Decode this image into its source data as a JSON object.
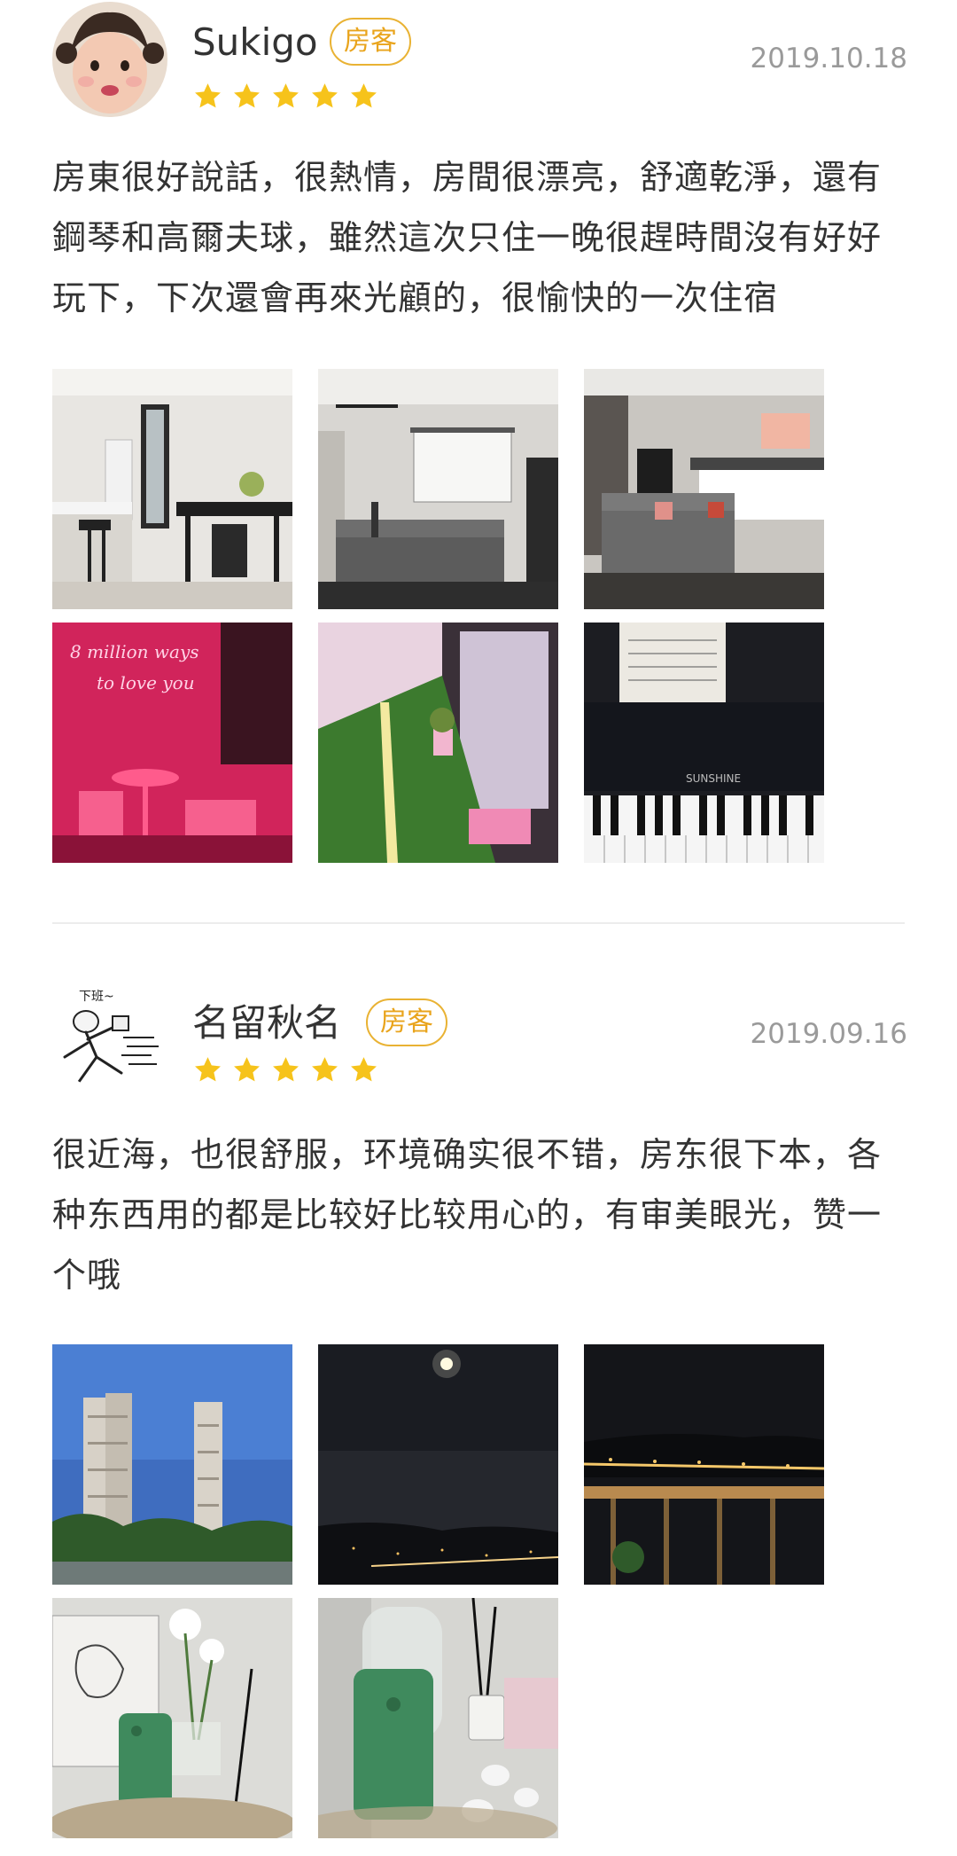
{
  "reviews": [
    {
      "username": "Sukigo",
      "badge": "房客",
      "rating": 5,
      "date": "2019.10.18",
      "avatar_icon": "child-face-avatar",
      "text": "房東很好說話，很熱情，房間很漂亮，舒適乾淨，還有鋼琴和高爾夫球，雖然這次只住一晚很趕時間沒有好好玩下，下次還會再來光顧的，很愉快的一次住宿",
      "photos": [
        "kitchen-dining",
        "living-room-projector",
        "bedroom-sofa",
        "neon-sign-balcony",
        "putting-green-balcony",
        "piano-keys"
      ],
      "neon_sign_text": "8 million ways to love you"
    },
    {
      "username": "名留秋名",
      "badge": "房客",
      "rating": 5,
      "date": "2019.09.16",
      "avatar_icon": "running-cartoon-avatar",
      "avatar_caption": "下班~",
      "text": "很近海，也很舒服，环境确实很不错，房东很下本，各种东西用的都是比较好比较用心的，有审美眼光，赞一个哦",
      "photos": [
        "high-rise-buildings",
        "night-sky-moon",
        "night-view-balcony",
        "phone-flowers",
        "phone-diffuser"
      ],
      "piano_brand": "SUNSHINE"
    }
  ],
  "colors": {
    "badge": "#e9a41c",
    "star": "#f6c31b",
    "date": "#9a9a9a",
    "text": "#333333",
    "divider": "#ececec"
  }
}
